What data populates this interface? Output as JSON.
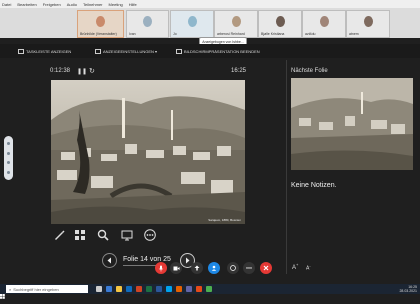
{
  "menu": [
    "Datei",
    "Bearbeiten",
    "Freigeben",
    "Audio",
    "Teilnehmer",
    "Meeting",
    "Hilfe"
  ],
  "participants": [
    {
      "name": "Brünhilde (Veranstalter)",
      "face": "#c98a6a",
      "bg": "#e6d6c6"
    },
    {
      "name": "Ivan",
      "face": "#9bb0c0",
      "bg": "#d0d6db"
    },
    {
      "name": "Jo",
      "face": "#8fb7cc",
      "bg": "#dfe8ee"
    },
    {
      "name": "arberosi Reinhard",
      "face": "#b29980",
      "bg": "#d8d0c6"
    },
    {
      "name": "Bjølle Kristiana",
      "face": "#6d5c52",
      "bg": "#cbc5bd"
    },
    {
      "name": "azt4du",
      "face": "#a08578",
      "bg": "#d2cbc4"
    },
    {
      "name": "atnem",
      "face": "#7e6a5e",
      "bg": "#d6d0ca"
    }
  ],
  "tooltip": "Anzeigebogen von Ishbe...",
  "toolbar": {
    "taskbar_show": "TASKLEISTE ANZEIGEN",
    "display_settings": "ANZEIGEEINSTELLUNGEN ▾",
    "end_slideshow": "BILDSCHIRMPRÄSENTATION BEENDEN"
  },
  "presenter": {
    "elapsed": "0:12:38",
    "clock": "16:25",
    "slide_credit": "Sarajevo, 1880, Bosnien",
    "next_label": "Nächste Folie",
    "notes": "Keine Notizen.",
    "slide_counter": "Folie 14 von 25"
  },
  "taskbar": {
    "search_placeholder": "Suchbegriff hier eingeben",
    "time": "16:25",
    "date": "28.03.2021"
  },
  "icons": {
    "prev": "chevron-left-icon",
    "next": "chevron-right-icon",
    "pen": "pen-icon",
    "all_slides": "grid-icon",
    "zoom": "magnifier-icon",
    "screen": "screen-icon",
    "more": "more-icon"
  },
  "colors": {
    "end_call": "#e53935",
    "mute": "#e53935",
    "share": "#1e88e5",
    "taskbar": "#1b2533"
  }
}
